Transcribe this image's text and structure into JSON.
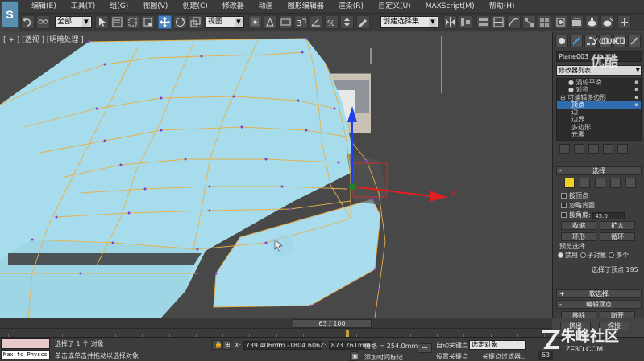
{
  "app": {
    "logo_letter": "S"
  },
  "menu": {
    "items": [
      "编辑(E)",
      "工具(T)",
      "组(G)",
      "视图(V)",
      "创建(C)",
      "修改器",
      "动画",
      "图形编辑器",
      "渲染(R)",
      "自定义(U)",
      "MAXScript(M)",
      "帮助(H)"
    ]
  },
  "toolbar": {
    "filter_select": "全部",
    "coord_select": "视图",
    "named_selection": "创建选择集"
  },
  "viewport": {
    "label": "[ + ] [透视 ] [明暗处理 ]",
    "colors": {
      "surface": "#a6dcec",
      "edge": "#e8b04a",
      "vertex": "#7a3fd8",
      "gizmo_x": "#e02020",
      "gizmo_z": "#1f3fe8",
      "gizmo_y": "#1a8a20"
    }
  },
  "panel": {
    "object_name": "Plane003",
    "modifier_list": "修改器列表",
    "stack": [
      {
        "label": "涡轮平滑",
        "indent": 1,
        "selected": false
      },
      {
        "label": "对称",
        "indent": 1,
        "selected": false
      },
      {
        "label": "可编辑多边形",
        "indent": 0,
        "selected": false
      },
      {
        "label": "顶点",
        "indent": 2,
        "selected": true
      },
      {
        "label": "边",
        "indent": 2,
        "selected": false
      },
      {
        "label": "边界",
        "indent": 2,
        "selected": false
      },
      {
        "label": "多边形",
        "indent": 2,
        "selected": false
      },
      {
        "label": "元素",
        "indent": 2,
        "selected": false
      }
    ],
    "selection_rollout": {
      "title": "选择",
      "by_vertex": "按顶点",
      "ignore_backfacing": "忽略背面",
      "by_angle": "按角度:",
      "angle_value": "45.0",
      "shrink": "收缩",
      "grow": "扩大",
      "ring": "环形",
      "loop": "循环",
      "preview_selection": "预览选择",
      "preview_off": "禁用",
      "preview_subobject": "子对象",
      "preview_multi": "多个",
      "selected_count": "选择了顶点 195"
    },
    "soft_selection": "软选择",
    "edit_vertices": "编辑顶点",
    "remove": "移除",
    "break": "断开",
    "extrude": "挤出",
    "weld": "焊接"
  },
  "timeline": {
    "frame": "63 / 100",
    "frame_current": 63,
    "frame_total": 100
  },
  "status": {
    "maxscript_line1": "",
    "maxscript_line2": "Max to Physcs !",
    "line1": "选择了 1 个 对象",
    "line2": "单击或单击并拖动以选择对象",
    "x_label": "X:",
    "x_value": "739.406mm",
    "y_label": "Y:",
    "y_value": "-1804.606",
    "z_label": "Z:",
    "z_value": "873.761mm",
    "grid": "栅格 = 254.0mm",
    "add_time_tag": "添加时间标记",
    "auto_key": "自动关键点",
    "set_key": "设置关键点",
    "selected_object": "选定对象",
    "key_filters": "关键点过滤器...",
    "frame_field": "63"
  },
  "watermarks": {
    "youku_en": "YOUKU",
    "youku_cn": "优酷",
    "zhufeng": "朱峰社区",
    "zhufeng_url": "ZF3D.COM"
  }
}
